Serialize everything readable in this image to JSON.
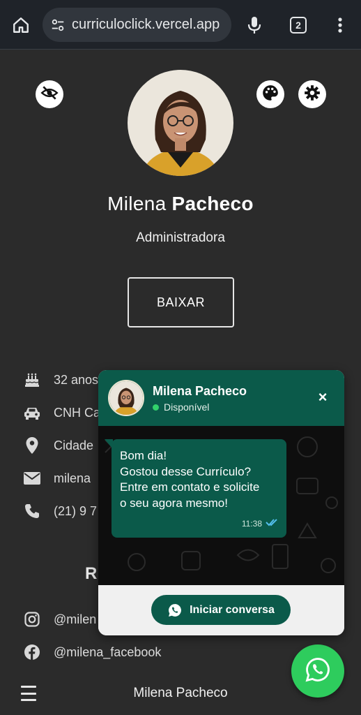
{
  "browser": {
    "url": "curriculoclick.vercel.app",
    "tab_count": "2",
    "icons": [
      "home-icon",
      "tune-icon",
      "mic-icon",
      "tabs-icon",
      "more-vert-icon"
    ]
  },
  "profile": {
    "first_name": "Milena",
    "last_name": "Pacheco",
    "role": "Administradora",
    "download_label": "BAIXAR"
  },
  "info": [
    {
      "icon": "birthday-cake-icon",
      "text": "32 anos"
    },
    {
      "icon": "car-icon",
      "text": "CNH Ca"
    },
    {
      "icon": "location-pin-icon",
      "text": "Cidade"
    },
    {
      "icon": "email-icon",
      "text": "milena"
    },
    {
      "icon": "phone-icon",
      "text": "(21) 9 7"
    }
  ],
  "social": {
    "heading": "R",
    "items": [
      {
        "icon": "instagram-icon",
        "text": "@milen"
      },
      {
        "icon": "facebook-icon",
        "text": "@milena_facebook"
      }
    ]
  },
  "bottom": {
    "name": "Milena Pacheco"
  },
  "chat": {
    "name": "Milena Pacheco",
    "status": "Disponível",
    "close": "×",
    "message_lines": [
      "Bom dia!",
      "Gostou desse Currículo?",
      "Entre em contato e solicite",
      "o seu agora mesmo!"
    ],
    "time": "11:38",
    "cta": "Iniciar conversa"
  },
  "colors": {
    "page_bg": "#2b2b2b",
    "chat_green": "#0b5a4a",
    "whatsapp_green": "#2ecc5d"
  }
}
